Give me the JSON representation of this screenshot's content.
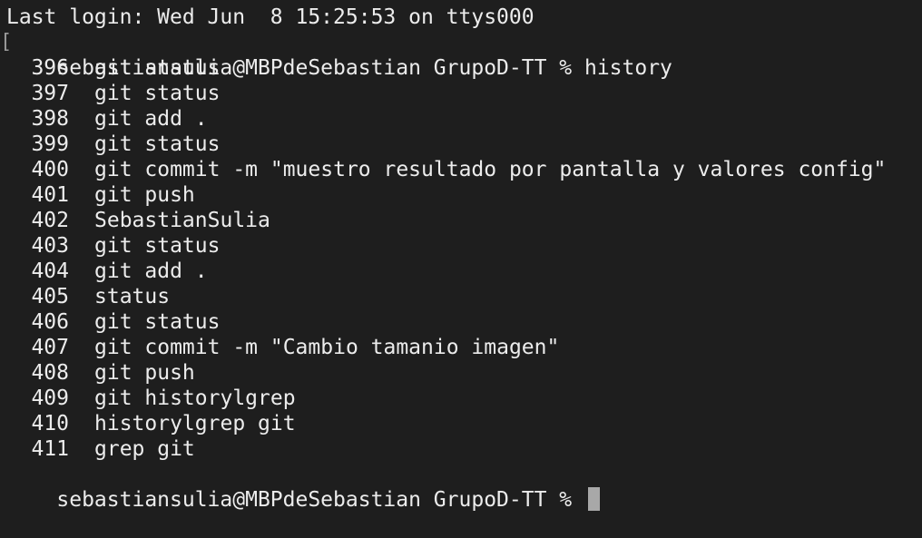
{
  "terminal": {
    "last_login": "Last login: Wed Jun  8 15:25:53 on ttys000",
    "bracket_marker": "[",
    "first_prompt": "sebastiansulia@MBPdeSebastian GrupoD-TT % history",
    "history": [
      {
        "num": "396",
        "cmd": "git status"
      },
      {
        "num": "397",
        "cmd": "git status"
      },
      {
        "num": "398",
        "cmd": "git add ."
      },
      {
        "num": "399",
        "cmd": "git status"
      },
      {
        "num": "400",
        "cmd": "git commit -m \"muestro resultado por pantalla y valores config\""
      },
      {
        "num": "401",
        "cmd": "git push"
      },
      {
        "num": "402",
        "cmd": "SebastianSulia"
      },
      {
        "num": "403",
        "cmd": "git status"
      },
      {
        "num": "404",
        "cmd": "git add ."
      },
      {
        "num": "405",
        "cmd": "status"
      },
      {
        "num": "406",
        "cmd": "git status"
      },
      {
        "num": "407",
        "cmd": "git commit -m \"Cambio tamanio imagen\""
      },
      {
        "num": "408",
        "cmd": "git push"
      },
      {
        "num": "409",
        "cmd": "git historylgrep"
      },
      {
        "num": "410",
        "cmd": "historylgrep git"
      },
      {
        "num": "411",
        "cmd": "grep git"
      }
    ],
    "final_prompt": "sebastiansulia@MBPdeSebastian GrupoD-TT % "
  }
}
